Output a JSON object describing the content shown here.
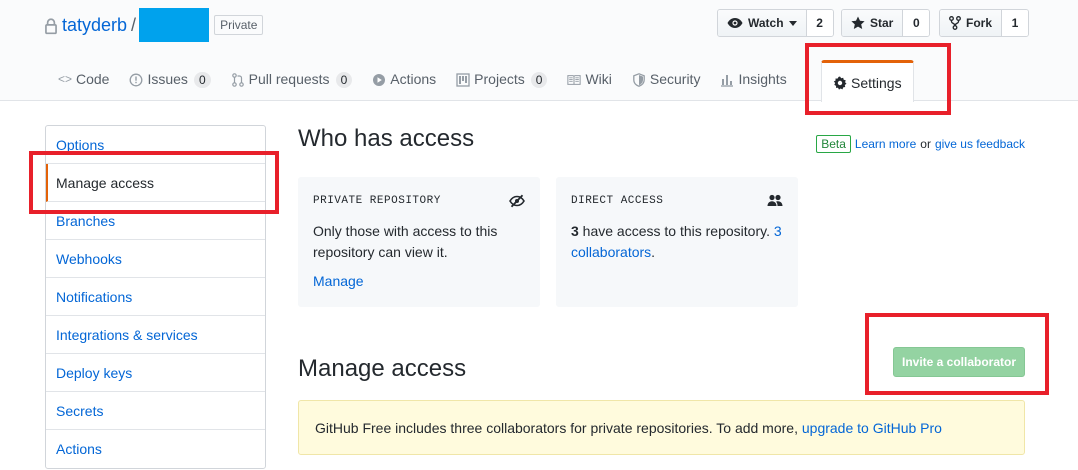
{
  "repo": {
    "owner": "tatyderb",
    "separator": "/",
    "visibility": "Private"
  },
  "actions": {
    "watch": {
      "label": "Watch",
      "count": "2"
    },
    "star": {
      "label": "Star",
      "count": "0"
    },
    "fork": {
      "label": "Fork",
      "count": "1"
    }
  },
  "tabs": [
    {
      "label": "Code",
      "icon": "code-icon"
    },
    {
      "label": "Issues",
      "icon": "issue-icon",
      "count": "0"
    },
    {
      "label": "Pull requests",
      "icon": "pull-request-icon",
      "count": "0"
    },
    {
      "label": "Actions",
      "icon": "play-icon"
    },
    {
      "label": "Projects",
      "icon": "project-icon",
      "count": "0"
    },
    {
      "label": "Wiki",
      "icon": "book-icon"
    },
    {
      "label": "Security",
      "icon": "shield-icon"
    },
    {
      "label": "Insights",
      "icon": "graph-icon"
    },
    {
      "label": "Settings",
      "icon": "gear-icon"
    }
  ],
  "menu": {
    "items": [
      {
        "label": "Options"
      },
      {
        "label": "Manage access"
      },
      {
        "label": "Branches"
      },
      {
        "label": "Webhooks"
      },
      {
        "label": "Notifications"
      },
      {
        "label": "Integrations & services"
      },
      {
        "label": "Deploy keys"
      },
      {
        "label": "Secrets"
      },
      {
        "label": "Actions"
      }
    ],
    "selected": "Manage access"
  },
  "who_has_access": {
    "title": "Who has access",
    "beta": "Beta",
    "learn_more": "Learn more",
    "or": "or",
    "feedback": "give us feedback",
    "private_card": {
      "heading": "PRIVATE REPOSITORY",
      "body": "Only those with access to this repository can view it.",
      "link": "Manage"
    },
    "direct_card": {
      "heading": "DIRECT ACCESS",
      "count": "3",
      "body": " have access to this repository. ",
      "link": "3 collaborators",
      "end": "."
    }
  },
  "manage_access": {
    "title": "Manage access",
    "invite_button": "Invite a collaborator",
    "flash_text": "GitHub Free includes three collaborators for private repositories. To add more, ",
    "flash_link": "upgrade to GitHub Pro"
  },
  "colors": {
    "link": "#0366d6",
    "accent_tab": "#e36209",
    "highlight": "#e8202a",
    "invite_disabled": "#94d3a2",
    "redaction": "#00a2ed"
  }
}
